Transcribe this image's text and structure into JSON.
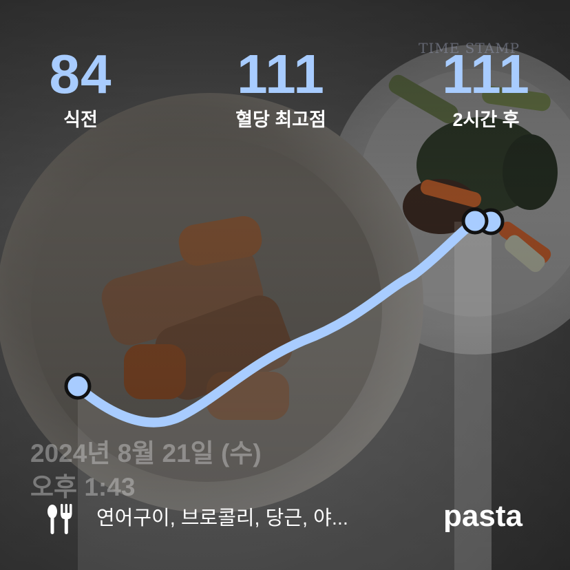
{
  "stats": {
    "before": {
      "value": "84",
      "label": "식전"
    },
    "peak": {
      "value": "111",
      "label": "혈당 최고점"
    },
    "after": {
      "value": "111",
      "label": "2시간 후"
    }
  },
  "timestamp": {
    "date": "2024년 8월 21일 (수)",
    "time": "오후 1:43"
  },
  "camera_stamp": "TIME STAMP",
  "meal": {
    "icon": "fork-knife-icon",
    "text": "연어구이, 브로콜리, 당근, 야..."
  },
  "brand": "pasta",
  "colors": {
    "accent": "#a8ccff",
    "label": "#ffffff",
    "marker_outline": "#111111"
  }
}
